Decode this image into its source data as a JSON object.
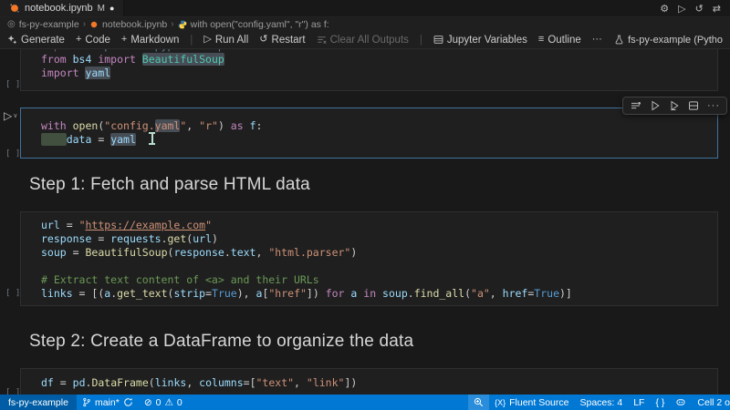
{
  "tab_bar": {
    "tab": {
      "title": "notebook.ipynb",
      "git_badge": "M",
      "dirty_dot": "●"
    },
    "actions": [
      {
        "name": "settings",
        "glyph": "⚙"
      },
      {
        "name": "run",
        "glyph": "▷"
      },
      {
        "name": "restart-kernel",
        "glyph": "↺"
      },
      {
        "name": "switch-kernel",
        "glyph": "⇄"
      }
    ]
  },
  "breadcrumb": {
    "items": [
      "fs-py-example",
      "notebook.ipynb",
      "with open(\"config.yaml\", \"r\") as f:"
    ]
  },
  "toolbar": {
    "generate": {
      "label": "Generate"
    },
    "code": {
      "label": "Code",
      "plus": "+"
    },
    "markdown": {
      "label": "Markdown",
      "plus": "+"
    },
    "run_all": {
      "label": "Run All",
      "glyph": "▷"
    },
    "restart": {
      "label": "Restart",
      "glyph": "↺"
    },
    "clear_outputs": {
      "label": "Clear All Outputs"
    },
    "jupyter_variables": {
      "label": "Jupyter Variables"
    },
    "outline": {
      "label": "Outline",
      "glyph": "≡"
    },
    "more": {
      "glyph": "···"
    },
    "kernel": {
      "label": "fs-py-example (Pytho"
    }
  },
  "cells": [
    {
      "type": "code",
      "exec": "[ ]",
      "lines": [
        [
          {
            "c": "kw",
            "x": "import "
          },
          {
            "c": "var",
            "x": "matplotlib.pyplot "
          },
          {
            "c": "kw",
            "x": "as "
          },
          {
            "c": "var",
            "x": "plt"
          }
        ],
        [
          {
            "c": "kw",
            "x": "from "
          },
          {
            "c": "var",
            "x": "bs4 "
          },
          {
            "c": "kw",
            "x": "import "
          },
          {
            "c": "cls",
            "x": "BeautifulSoup",
            "h": "hl"
          }
        ],
        [
          {
            "c": "kw",
            "x": "import "
          },
          {
            "c": "var",
            "x": "yaml",
            "h": "hl"
          }
        ]
      ]
    },
    {
      "type": "code",
      "exec": "[ ]",
      "active": true,
      "lines": [
        [
          {
            "c": "kw",
            "x": "with "
          },
          {
            "c": "fn",
            "x": "open"
          },
          {
            "c": "punc",
            "x": "("
          },
          {
            "c": "str",
            "x": "\"config."
          },
          {
            "c": "str",
            "x": "yaml",
            "h": "hl"
          },
          {
            "c": "str",
            "x": "\""
          },
          {
            "c": "punc",
            "x": ", "
          },
          {
            "c": "str",
            "x": "\"r\""
          },
          {
            "c": "punc",
            "x": ") "
          },
          {
            "c": "kw",
            "x": "as "
          },
          {
            "c": "var",
            "x": "f"
          },
          {
            "c": "punc",
            "x": ":"
          }
        ],
        [
          {
            "c": "punc",
            "x": "    ",
            "h": "hl-green"
          },
          {
            "c": "var",
            "x": "data "
          },
          {
            "c": "punc",
            "x": "= "
          },
          {
            "c": "var",
            "x": "yaml",
            "h": "hl"
          }
        ]
      ]
    },
    {
      "type": "markdown",
      "text": "Step 1: Fetch and parse HTML data"
    },
    {
      "type": "code",
      "exec": "[ ]",
      "lines": [
        [
          {
            "c": "var",
            "x": "url "
          },
          {
            "c": "punc",
            "x": "= "
          },
          {
            "c": "str",
            "x": "\""
          },
          {
            "c": "str",
            "x": "https://example.com",
            "h": "link"
          },
          {
            "c": "str",
            "x": "\""
          }
        ],
        [
          {
            "c": "var",
            "x": "response "
          },
          {
            "c": "punc",
            "x": "= "
          },
          {
            "c": "var",
            "x": "requests"
          },
          {
            "c": "punc",
            "x": "."
          },
          {
            "c": "fn",
            "x": "get"
          },
          {
            "c": "punc",
            "x": "("
          },
          {
            "c": "var",
            "x": "url"
          },
          {
            "c": "punc",
            "x": ")"
          }
        ],
        [
          {
            "c": "var",
            "x": "soup "
          },
          {
            "c": "punc",
            "x": "= "
          },
          {
            "c": "fn",
            "x": "BeautifulSoup"
          },
          {
            "c": "punc",
            "x": "("
          },
          {
            "c": "var",
            "x": "response"
          },
          {
            "c": "punc",
            "x": "."
          },
          {
            "c": "var",
            "x": "text"
          },
          {
            "c": "punc",
            "x": ", "
          },
          {
            "c": "str",
            "x": "\"html.parser\""
          },
          {
            "c": "punc",
            "x": ")"
          }
        ],
        [],
        [
          {
            "c": "com",
            "x": "# Extract text content of <a> and their URLs"
          }
        ],
        [
          {
            "c": "var",
            "x": "links "
          },
          {
            "c": "punc",
            "x": "= [("
          },
          {
            "c": "var",
            "x": "a"
          },
          {
            "c": "punc",
            "x": "."
          },
          {
            "c": "fn",
            "x": "get_text"
          },
          {
            "c": "punc",
            "x": "("
          },
          {
            "c": "var",
            "x": "strip"
          },
          {
            "c": "punc",
            "x": "="
          },
          {
            "c": "const",
            "x": "True"
          },
          {
            "c": "punc",
            "x": "), "
          },
          {
            "c": "var",
            "x": "a"
          },
          {
            "c": "punc",
            "x": "["
          },
          {
            "c": "str",
            "x": "\"href\""
          },
          {
            "c": "punc",
            "x": "]) "
          },
          {
            "c": "kw",
            "x": "for "
          },
          {
            "c": "var",
            "x": "a "
          },
          {
            "c": "kw",
            "x": "in "
          },
          {
            "c": "var",
            "x": "soup"
          },
          {
            "c": "punc",
            "x": "."
          },
          {
            "c": "fn",
            "x": "find_all"
          },
          {
            "c": "punc",
            "x": "("
          },
          {
            "c": "str",
            "x": "\"a\""
          },
          {
            "c": "punc",
            "x": ", "
          },
          {
            "c": "var",
            "x": "href"
          },
          {
            "c": "punc",
            "x": "="
          },
          {
            "c": "const",
            "x": "True"
          },
          {
            "c": "punc",
            "x": ")]"
          }
        ]
      ]
    },
    {
      "type": "markdown",
      "text": "Step 2: Create a DataFrame to organize the data"
    },
    {
      "type": "code",
      "exec": "[ ]",
      "lines": [
        [
          {
            "c": "var",
            "x": "df "
          },
          {
            "c": "punc",
            "x": "= "
          },
          {
            "c": "var",
            "x": "pd"
          },
          {
            "c": "punc",
            "x": "."
          },
          {
            "c": "fn",
            "x": "DataFrame"
          },
          {
            "c": "punc",
            "x": "("
          },
          {
            "c": "var",
            "x": "links"
          },
          {
            "c": "punc",
            "x": ", "
          },
          {
            "c": "var",
            "x": "columns"
          },
          {
            "c": "punc",
            "x": "=["
          },
          {
            "c": "str",
            "x": "\"text\""
          },
          {
            "c": "punc",
            "x": ", "
          },
          {
            "c": "str",
            "x": "\"link\""
          },
          {
            "c": "punc",
            "x": "])"
          }
        ]
      ]
    }
  ],
  "status_bar": {
    "left": {
      "remote": {
        "label": "fs-py-example"
      },
      "branch": {
        "label": "main*"
      },
      "problems": {
        "errors": "0",
        "warnings": "0",
        "error_glyph": "⊘",
        "warning_glyph": "⚠"
      }
    },
    "right": {
      "fluent": {
        "icon_text": "{X}",
        "label": "Fluent Source"
      },
      "spaces": "Spaces: 4",
      "eol": "LF",
      "braces": "{ }",
      "cell_indicator": "Cell 2 o"
    }
  },
  "colors": {
    "accent": "#0078d4",
    "editor_bg": "#1f1f1f",
    "page_bg": "#191919",
    "active_cell_border": "#41719c",
    "jupyter_orange": "#f37726"
  }
}
